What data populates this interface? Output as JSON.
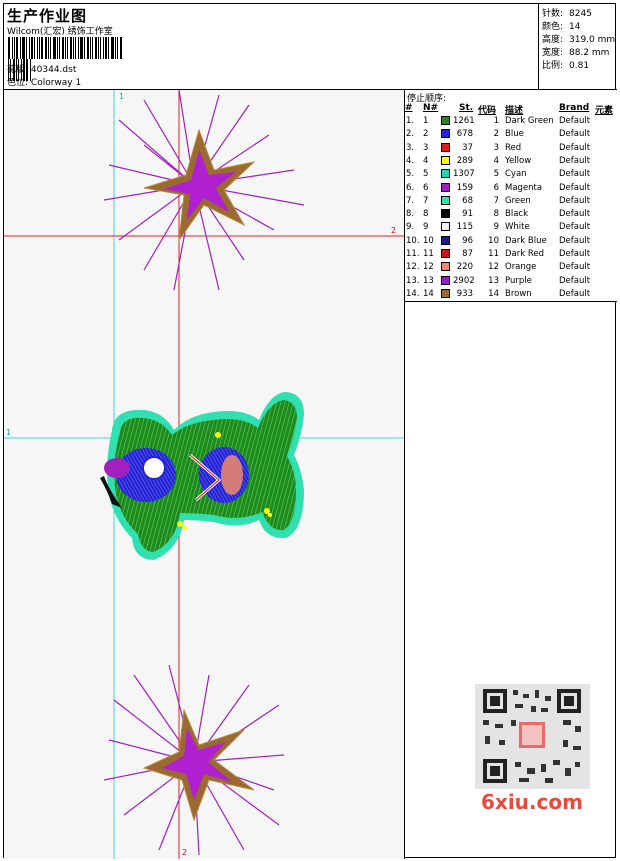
{
  "header": {
    "title": "生产作业图",
    "company": "Wilcom(汇宏) 绣饰工作室",
    "design_label": "花版:",
    "design_value": "40344.dst",
    "colorway_label": "色位:",
    "colorway_value": "Colorway 1"
  },
  "stats": [
    {
      "label": "针数:",
      "value": "8245"
    },
    {
      "label": "颜色:",
      "value": "14"
    },
    {
      "label": "高度:",
      "value": "319.0 mm"
    },
    {
      "label": "宽度:",
      "value": "88.2 mm"
    },
    {
      "label": "比例:",
      "value": "0.81"
    }
  ],
  "stop_sequence": {
    "title": "停止顺序:",
    "columns": {
      "num": "#",
      "needle": "N#",
      "stitches": "St.",
      "code": "代码",
      "description": "描述",
      "brand": "Brand",
      "element": "元素"
    },
    "rows": [
      {
        "num": "1.",
        "needle": "1",
        "color": "#1e8a1e",
        "stitches": "1261",
        "code": "1",
        "description": "Dark Green",
        "brand": "Default"
      },
      {
        "num": "2.",
        "needle": "2",
        "color": "#2323d8",
        "stitches": "678",
        "code": "2",
        "description": "Blue",
        "brand": "Default"
      },
      {
        "num": "3.",
        "needle": "3",
        "color": "#e31a1a",
        "stitches": "37",
        "code": "3",
        "description": "Red",
        "brand": "Default"
      },
      {
        "num": "4.",
        "needle": "4",
        "color": "#ffff00",
        "stitches": "289",
        "code": "4",
        "description": "Yellow",
        "brand": "Default"
      },
      {
        "num": "5.",
        "needle": "5",
        "color": "#20d8b8",
        "stitches": "1307",
        "code": "5",
        "description": "Cyan",
        "brand": "Default"
      },
      {
        "num": "6.",
        "needle": "6",
        "color": "#a020c0",
        "stitches": "159",
        "code": "6",
        "description": "Magenta",
        "brand": "Default"
      },
      {
        "num": "7.",
        "needle": "7",
        "color": "#30e0b0",
        "stitches": "68",
        "code": "7",
        "description": "Green",
        "brand": "Default"
      },
      {
        "num": "8.",
        "needle": "8",
        "color": "#000000",
        "stitches": "91",
        "code": "8",
        "description": "Black",
        "brand": "Default"
      },
      {
        "num": "9.",
        "needle": "9",
        "color": "#f4f4f4",
        "stitches": "115",
        "code": "9",
        "description": "White",
        "brand": "Default"
      },
      {
        "num": "10.",
        "needle": "10",
        "color": "#1a1a8a",
        "stitches": "96",
        "code": "10",
        "description": "Dark Blue",
        "brand": "Default"
      },
      {
        "num": "11.",
        "needle": "11",
        "color": "#c81414",
        "stitches": "87",
        "code": "11",
        "description": "Dark Red",
        "brand": "Default"
      },
      {
        "num": "12.",
        "needle": "12",
        "color": "#f08a6a",
        "stitches": "220",
        "code": "12",
        "description": "Orange",
        "brand": "Default"
      },
      {
        "num": "13.",
        "needle": "13",
        "color": "#9c1ad0",
        "stitches": "2902",
        "code": "13",
        "description": "Purple",
        "brand": "Default"
      },
      {
        "num": "14.",
        "needle": "14",
        "color": "#9a6a30",
        "stitches": "933",
        "code": "14",
        "description": "Brown",
        "brand": "Default"
      }
    ]
  },
  "guides": {
    "v1": "1",
    "v2": "2",
    "h1": "1",
    "h2": "2"
  },
  "watermark": "6xiu.com"
}
